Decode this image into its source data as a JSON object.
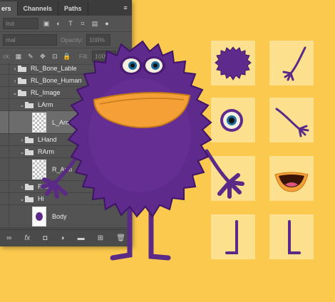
{
  "panel": {
    "tabs": [
      "ers",
      "Channels",
      "Paths"
    ],
    "kind_field": "Ind",
    "blend_field": "mal",
    "opacity_label": "Opacity:",
    "opacity_value": "100%",
    "lock_label": "ck:",
    "fill_label": "Fill:",
    "fill_value": "100%",
    "layers": [
      {
        "name": "RL_Bone_Lable",
        "kind": "group",
        "depth": 0,
        "expanded": false,
        "selected": false
      },
      {
        "name": "RL_Bone_Human",
        "kind": "group",
        "depth": 0,
        "expanded": false,
        "selected": false
      },
      {
        "name": "RL_Image",
        "kind": "group",
        "depth": 0,
        "expanded": true,
        "selected": false
      },
      {
        "name": "LArm",
        "kind": "group",
        "depth": 1,
        "expanded": true,
        "selected": false
      },
      {
        "name": "L_Arm",
        "kind": "layer",
        "depth": 2,
        "selected": true
      },
      {
        "name": "LHand",
        "kind": "group",
        "depth": 1,
        "expanded": false,
        "selected": false
      },
      {
        "name": "RArm",
        "kind": "group",
        "depth": 1,
        "expanded": true,
        "selected": false
      },
      {
        "name": "R_Arm",
        "kind": "layer",
        "depth": 2,
        "selected": false
      },
      {
        "name": "RHan",
        "kind": "group",
        "depth": 1,
        "expanded": false,
        "selected": false
      },
      {
        "name": "Hi",
        "kind": "group",
        "depth": 1,
        "expanded": true,
        "selected": false
      },
      {
        "name": "Body",
        "kind": "layer",
        "depth": 2,
        "selected": false
      }
    ],
    "footer_icons": [
      "link-icon",
      "fx-icon",
      "mask-icon",
      "adjustment-icon",
      "folder-icon",
      "new-layer-icon",
      "trash-icon"
    ]
  },
  "colors": {
    "background": "#fbc94e",
    "tile": "#fde08d",
    "fur": "#5e2a8c",
    "fur_dark": "#3f1566",
    "beak": "#f4a037",
    "limb": "#5a2a86"
  },
  "sprite_parts": [
    "fur-ball-body",
    "arm-with-hand",
    "eyeball",
    "arm-with-hand",
    "mouth",
    "leg",
    "leg"
  ]
}
